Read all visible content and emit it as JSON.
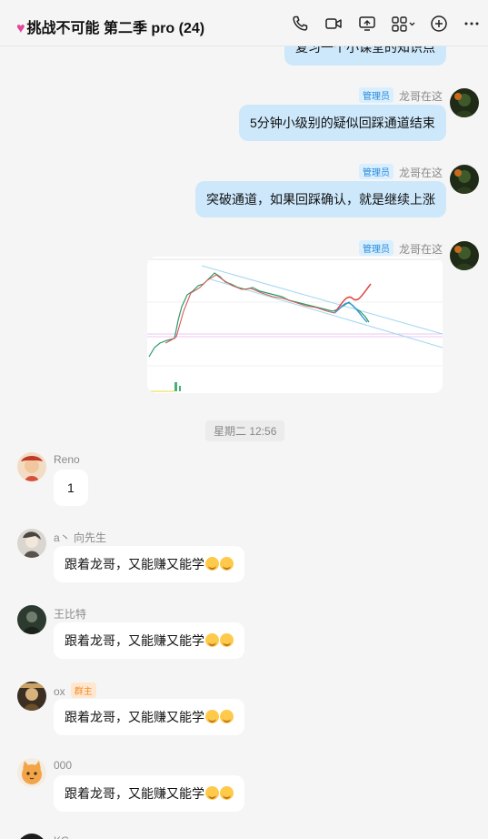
{
  "header": {
    "title": "挑战不可能 第二季 pro (24)",
    "icons": [
      "phone-icon",
      "video-icon",
      "screen-share-icon",
      "apps-icon",
      "add-icon",
      "more-icon"
    ]
  },
  "messages_self": [
    {
      "text": "复习一个小课堂的知识点"
    },
    {
      "badge": "管理员",
      "sender": "龙哥在这",
      "text": "5分钟小级别的疑似回踩通道结束"
    },
    {
      "badge": "管理员",
      "sender": "龙哥在这",
      "text": "突破通道，如果回踩确认，就是继续上涨"
    },
    {
      "badge": "管理员",
      "sender": "龙哥在这"
    }
  ],
  "divider": {
    "time": "星期二 12:56"
  },
  "messages_other": [
    {
      "sender": "Reno",
      "text": "1"
    },
    {
      "sender": "a丶 向先生",
      "text": "跟着龙哥，又能赚又能学"
    },
    {
      "sender": "王比特",
      "text": "跟着龙哥，又能赚又能学"
    },
    {
      "sender": "ox",
      "badge": "群主",
      "text": "跟着龙哥，又能赚又能学"
    },
    {
      "sender": "000",
      "text": "跟着龙哥，又能赚又能学"
    },
    {
      "sender": "KG"
    }
  ],
  "colors": {
    "self_bubble": "#cde8fb",
    "background": "#f5f5f5",
    "admin_badge": "#2688d8",
    "owner_badge": "#f08c2a"
  }
}
